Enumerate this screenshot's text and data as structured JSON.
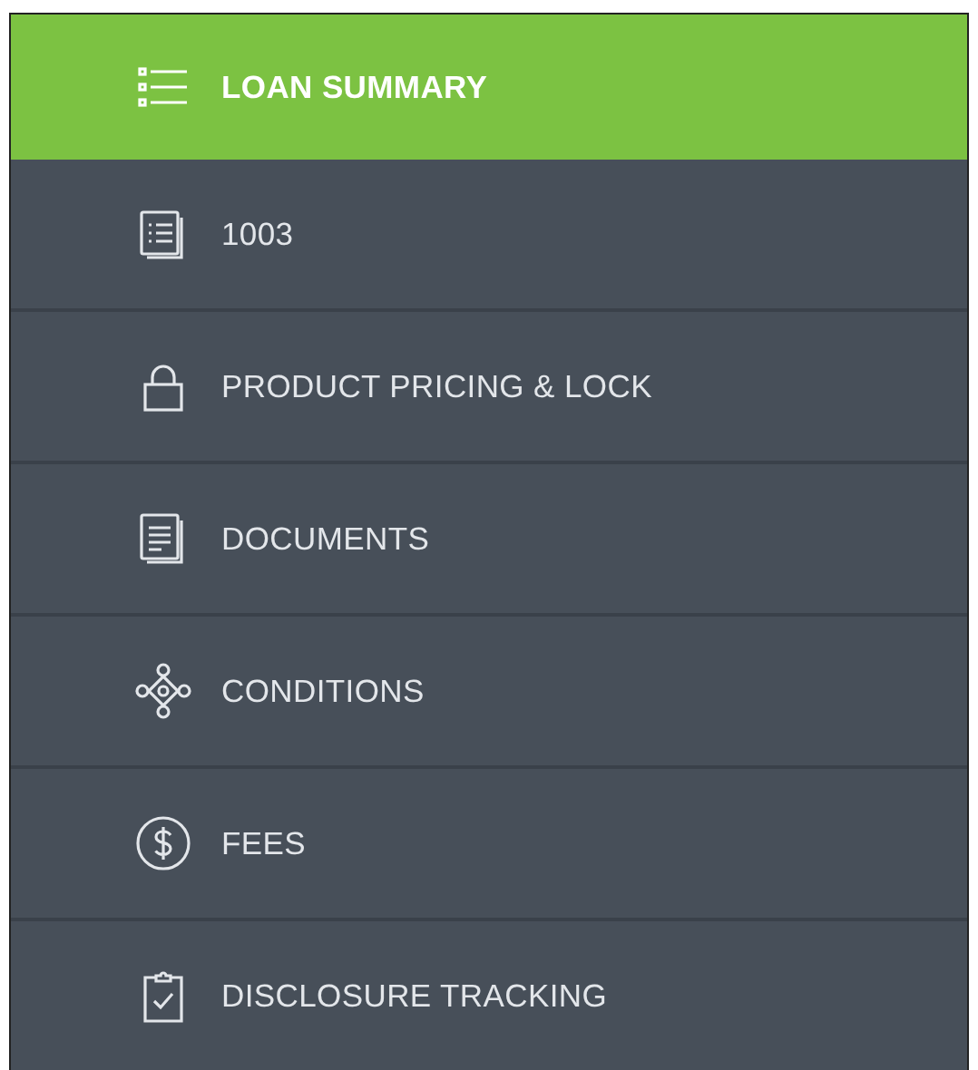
{
  "nav_items": [
    {
      "label": "LOAN SUMMARY",
      "selected": true
    },
    {
      "label": "1003",
      "selected": false
    },
    {
      "label": "PRODUCT PRICING & LOCK",
      "selected": false
    },
    {
      "label": "DOCUMENTS",
      "selected": false
    },
    {
      "label": "CONDITIONS",
      "selected": false
    },
    {
      "label": "FEES",
      "selected": false
    },
    {
      "label": "DISCLOSURE TRACKING",
      "selected": false
    }
  ]
}
